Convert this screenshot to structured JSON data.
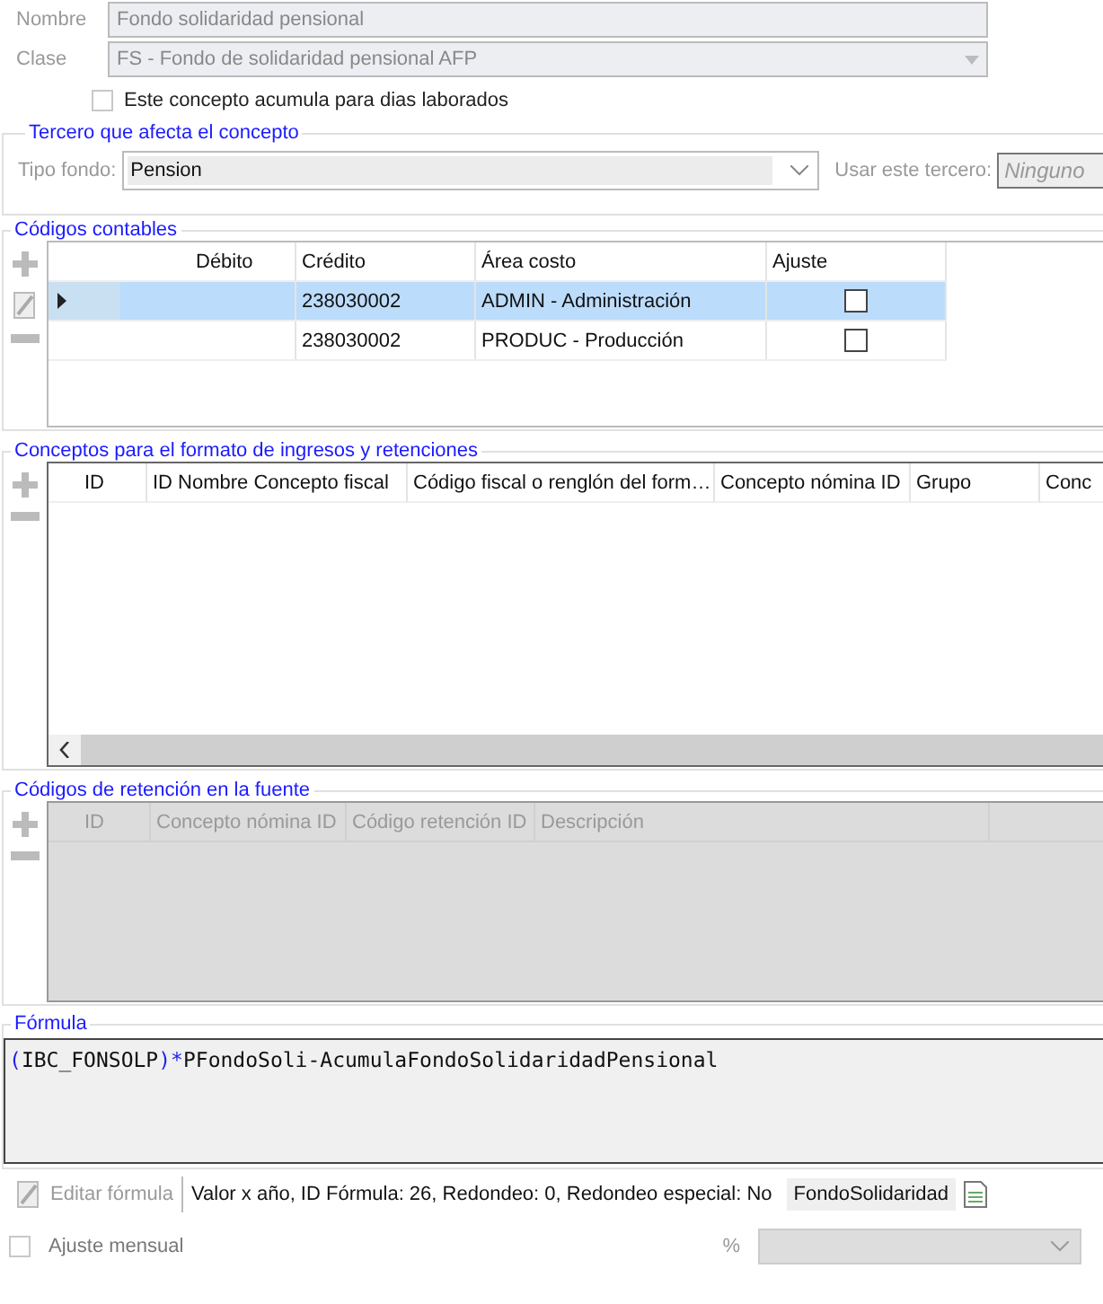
{
  "nombre": {
    "label": "Nombre",
    "value": "Fondo solidaridad pensional"
  },
  "clase": {
    "label": "Clase",
    "value": "FS - Fondo de solidaridad pensional AFP"
  },
  "acumula": {
    "label": "Este concepto acumula para dias laborados",
    "checked": false
  },
  "tercero": {
    "title": "Tercero que afecta el concepto",
    "tipo_label": "Tipo fondo:",
    "tipo_value": "Pension",
    "usar_label": "Usar este tercero:",
    "usar_placeholder": "Ninguno"
  },
  "codigos": {
    "title": "Códigos contables",
    "columns": [
      "Débito",
      "Crédito",
      "Área costo",
      "Ajuste"
    ],
    "rows": [
      {
        "debito": "",
        "credito": "238030002",
        "area": "ADMIN - Administración",
        "ajuste": false,
        "selected": true
      },
      {
        "debito": "",
        "credito": "238030002",
        "area": "PRODUC - Producción",
        "ajuste": false,
        "selected": false
      }
    ]
  },
  "conceptos": {
    "title": "Conceptos para el formato de ingresos y retenciones",
    "columns": [
      "ID",
      "ID Nombre Concepto fiscal",
      "Código fiscal o renglón del form…",
      "Concepto nómina ID",
      "Grupo",
      "Conc"
    ]
  },
  "retencion": {
    "title": "Códigos de retención en la fuente",
    "columns": [
      "ID",
      "Concepto nómina ID",
      "Código retención ID",
      "Descripción"
    ]
  },
  "formula": {
    "title": "Fórmula",
    "tokens": [
      {
        "text": "(",
        "kind": "op"
      },
      {
        "text": "IBC_FONSOLP",
        "kind": "var"
      },
      {
        "text": ")",
        "kind": "op"
      },
      {
        "text": "*",
        "kind": "op"
      },
      {
        "text": "PFondoSoli-AcumulaFondoSolidaridadPensional",
        "kind": "var"
      }
    ],
    "edit_label": "Editar fórmula",
    "info": "Valor x año,  ID Fórmula: 26, Redondeo: 0, Redondeo especial: No",
    "name": "FondoSolidaridad"
  },
  "ajuste_mensual": {
    "label": "Ajuste mensual",
    "checked": false,
    "percent_label": "%"
  }
}
